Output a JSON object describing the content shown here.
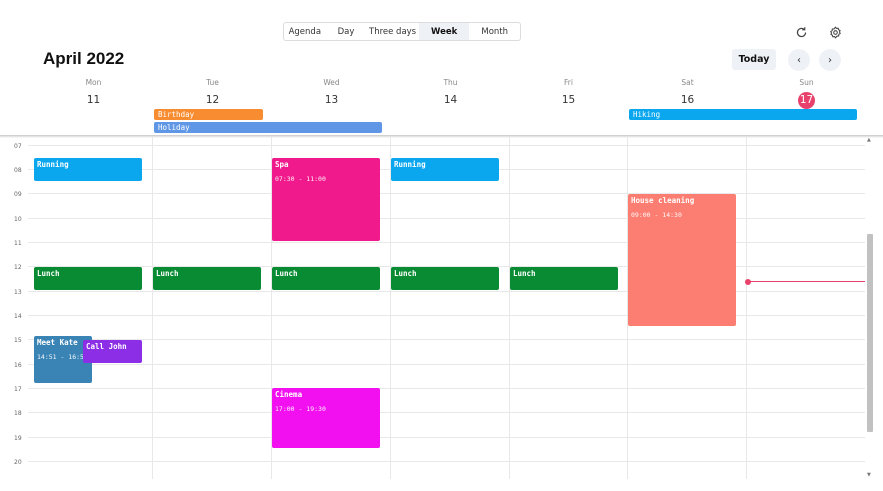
{
  "views": [
    {
      "label": "Agenda",
      "active": false
    },
    {
      "label": "Day",
      "active": false
    },
    {
      "label": "Three days",
      "active": false
    },
    {
      "label": "Week",
      "active": true
    },
    {
      "label": "Month",
      "active": false
    }
  ],
  "title": "April 2022",
  "today_label": "Today",
  "prev_label": "‹",
  "next_label": "›",
  "days": [
    {
      "name": "Mon",
      "num": "11",
      "today": false
    },
    {
      "name": "Tue",
      "num": "12",
      "today": false
    },
    {
      "name": "Wed",
      "num": "13",
      "today": false
    },
    {
      "name": "Thu",
      "num": "14",
      "today": false
    },
    {
      "name": "Fri",
      "num": "15",
      "today": false
    },
    {
      "name": "Sat",
      "num": "16",
      "today": false
    },
    {
      "name": "Sun",
      "num": "17",
      "today": true
    }
  ],
  "allday_events": [
    {
      "title": "Birthday",
      "color": "#f78c30"
    },
    {
      "title": "Holiday",
      "color": "#5f97e6"
    },
    {
      "title": "Hiking",
      "color": "#0aa6ee"
    }
  ],
  "hours": [
    "07",
    "08",
    "09",
    "10",
    "11",
    "12",
    "13",
    "14",
    "15",
    "16",
    "17",
    "18",
    "19",
    "20"
  ],
  "events": [
    {
      "title": "Running",
      "time": "",
      "color": "#0aa6ee"
    },
    {
      "title": "Spa",
      "time": "07:30 - 11:00",
      "color": "#f01a8c"
    },
    {
      "title": "Running",
      "time": "",
      "color": "#0aa6ee"
    },
    {
      "title": "House cleaning",
      "time": "09:00 - 14:30",
      "color": "#fc7e72"
    },
    {
      "title": "Lunch",
      "time": "",
      "color": "#098b34"
    },
    {
      "title": "Lunch",
      "time": "",
      "color": "#098b34"
    },
    {
      "title": "Lunch",
      "time": "",
      "color": "#098b34"
    },
    {
      "title": "Lunch",
      "time": "",
      "color": "#098b34"
    },
    {
      "title": "Lunch",
      "time": "",
      "color": "#098b34"
    },
    {
      "title": "Meet Kate",
      "time": "14:51 - 16:5",
      "color": "#3a83b5"
    },
    {
      "title": "Call John",
      "time": "",
      "color": "#8c2ee6"
    },
    {
      "title": "Cinema",
      "time": "17:00 - 19:30",
      "color": "#f20ff0"
    }
  ],
  "colors": {
    "accent": "#e8416b",
    "button_bg": "#eef1f6"
  }
}
